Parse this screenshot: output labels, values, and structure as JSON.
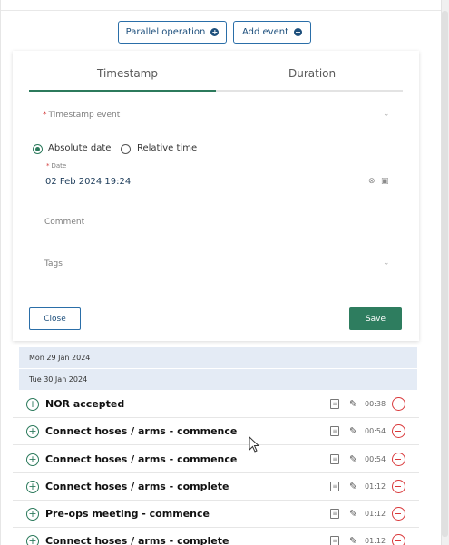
{
  "toolbar": {
    "parallel_label": "Parallel operation",
    "add_event_label": "Add event"
  },
  "form": {
    "tabs": [
      {
        "label": "Timestamp",
        "active": true
      },
      {
        "label": "Duration",
        "active": false
      }
    ],
    "timestamp_event_label": "Timestamp event",
    "radio_absolute": "Absolute date",
    "radio_relative": "Relative time",
    "selected_mode": "Absolute date",
    "date_label": "Date",
    "date_value": "02 Feb 2024 19:24",
    "comment_placeholder": "Comment",
    "tags_placeholder": "Tags",
    "close_label": "Close",
    "save_label": "Save"
  },
  "timeline": {
    "date_groups": [
      "Mon 29 Jan 2024",
      "Tue 30 Jan 2024"
    ],
    "events": [
      {
        "name": "NOR accepted",
        "time": "00:38"
      },
      {
        "name": "Connect hoses / arms - commence",
        "time": "00:54"
      },
      {
        "name": "Connect hoses / arms - commence",
        "time": "00:54"
      },
      {
        "name": "Connect hoses / arms - complete",
        "time": "01:12"
      },
      {
        "name": "Pre-ops meeting - commence",
        "time": "01:12"
      },
      {
        "name": "Connect hoses / arms - complete",
        "time": "01:12"
      }
    ]
  },
  "colors": {
    "accent_green": "#2e7d5f",
    "link_blue": "#1d4f7c",
    "danger_red": "#d9383a",
    "date_row_bg": "#e4ebf5"
  }
}
